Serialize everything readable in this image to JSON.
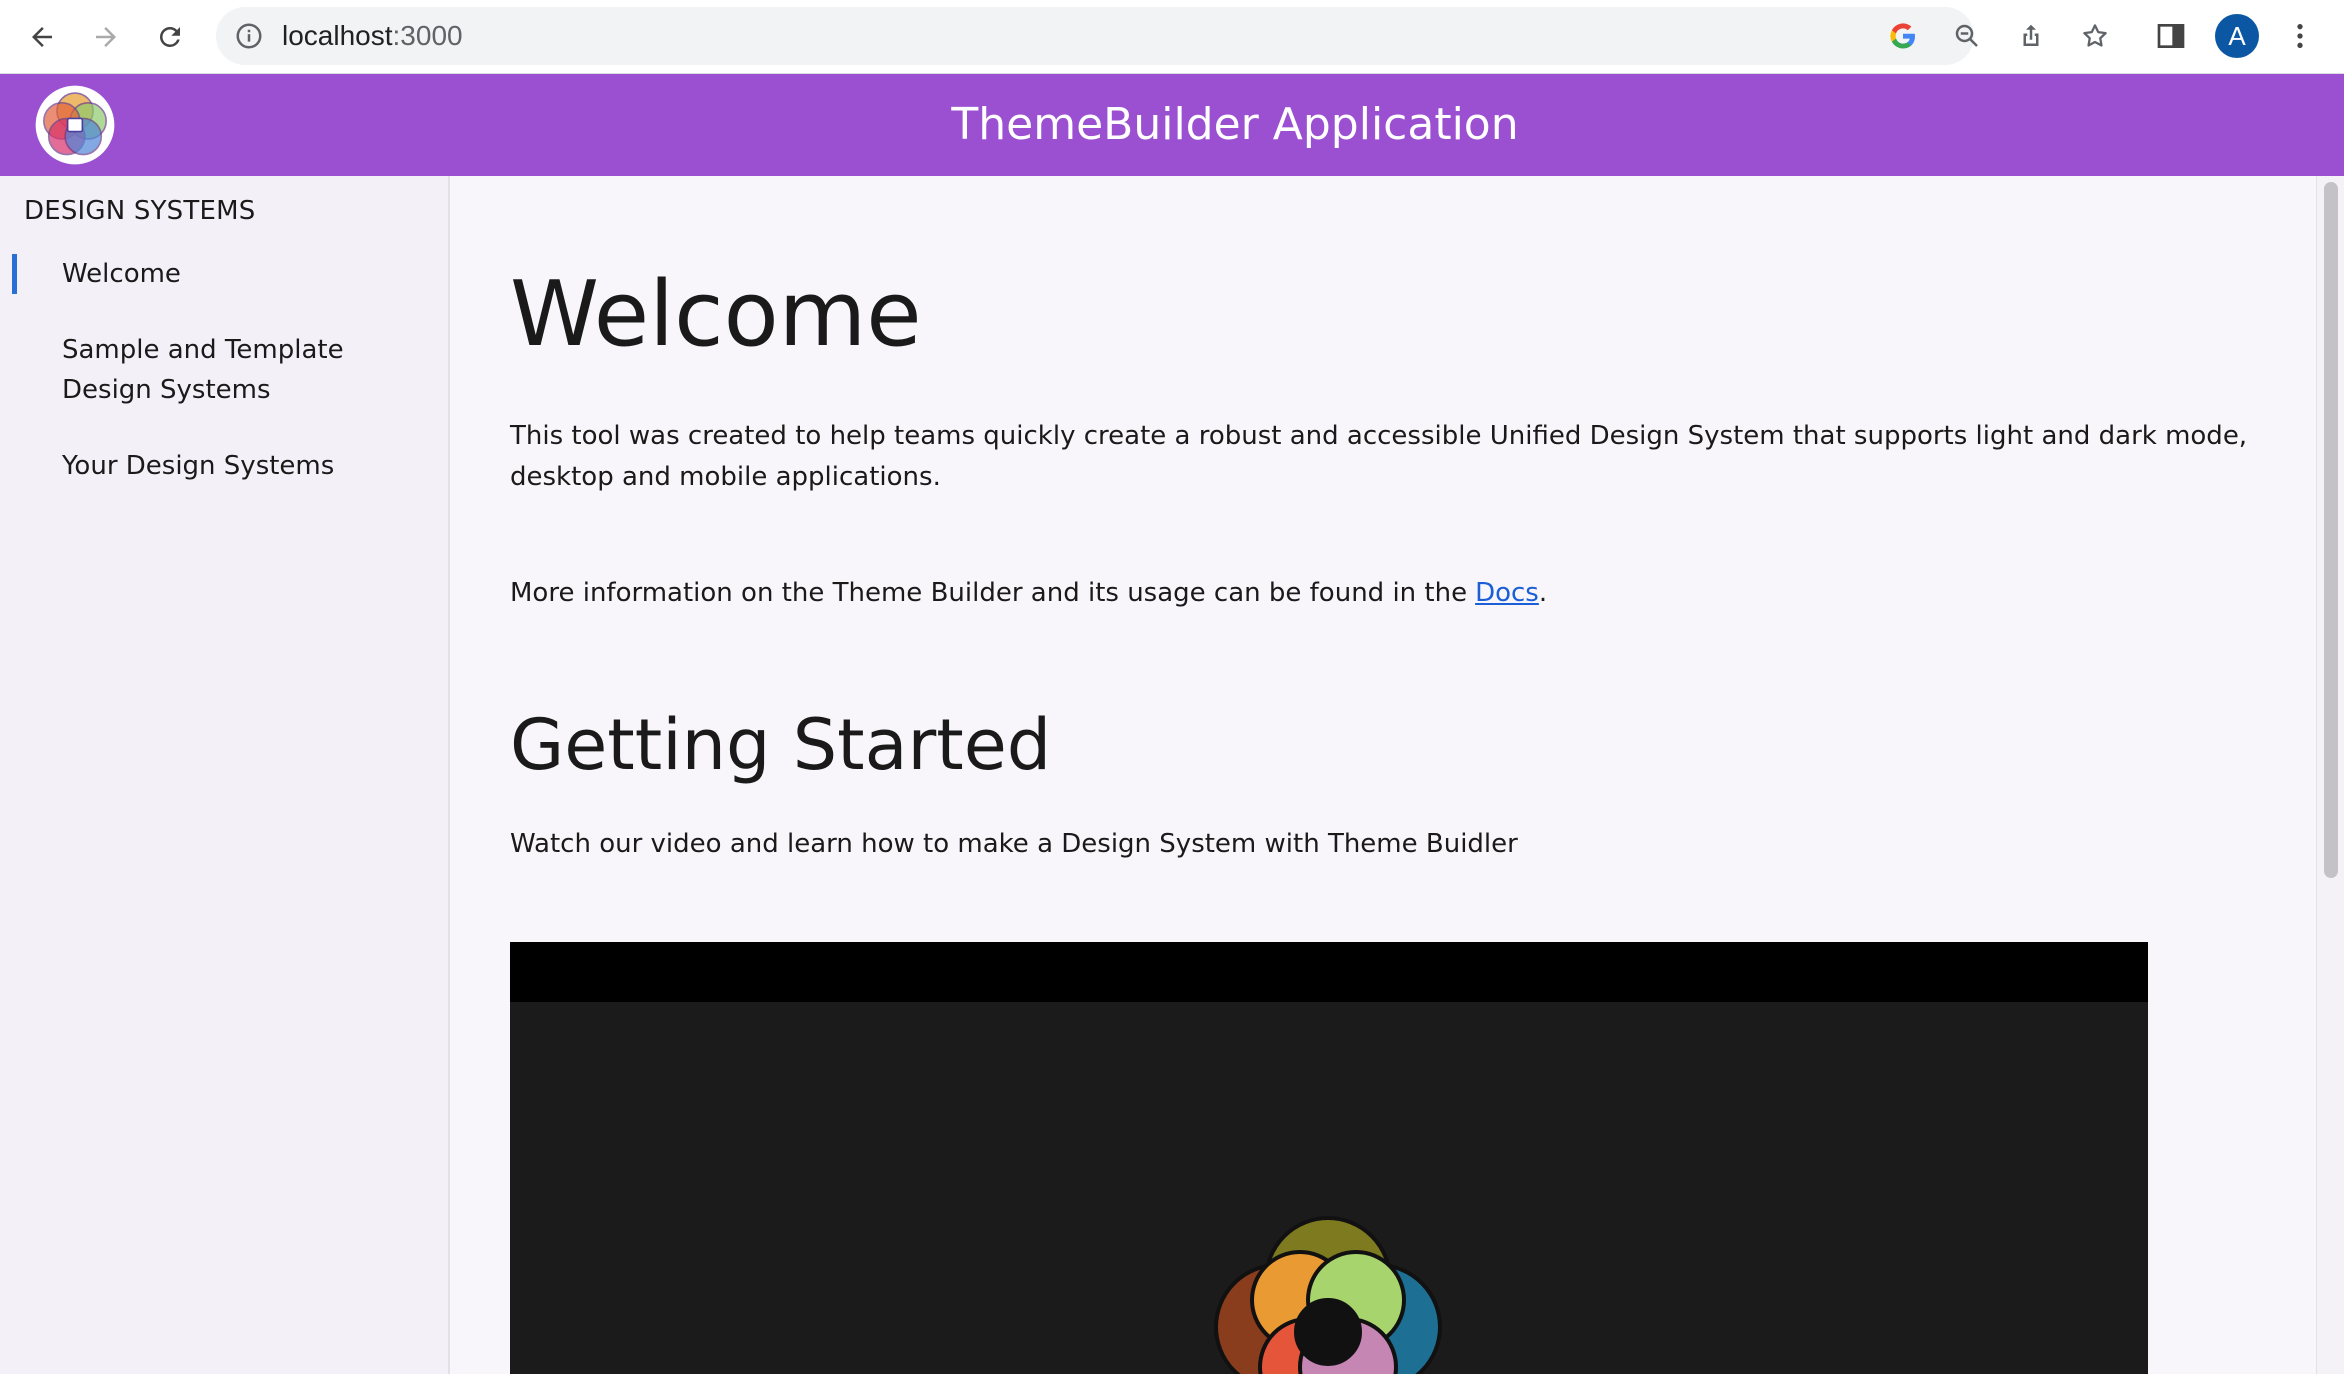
{
  "browser": {
    "url_host": "localhost",
    "url_port": ":3000",
    "profile_initial": "A",
    "icons": [
      "back-icon",
      "forward-icon",
      "reload-icon",
      "info-icon",
      "google-icon",
      "zoom-out-icon",
      "share-icon",
      "star-icon",
      "side-panel-icon",
      "more-icon"
    ]
  },
  "app": {
    "title": "ThemeBuilder Application",
    "accent_color": "#9b4fd1"
  },
  "sidebar": {
    "heading": "DESIGN SYSTEMS",
    "items": [
      {
        "label": "Welcome",
        "active": true
      },
      {
        "label": "Sample and Template Design Systems",
        "active": false
      },
      {
        "label": "Your Design Systems",
        "active": false
      }
    ]
  },
  "main": {
    "title": "Welcome",
    "intro": "This tool was created to help teams quickly create a robust and accessible Unified Design System that supports light and dark mode, desktop and mobile applications.",
    "docs_text": "More information on the Theme Builder and its usage can be found in the",
    "docs_link": "Docs",
    "docs_suffix": ".",
    "getting_started_title": "Getting Started",
    "getting_started_text": "Watch our video and learn how to make a Design System with Theme Buidler"
  }
}
